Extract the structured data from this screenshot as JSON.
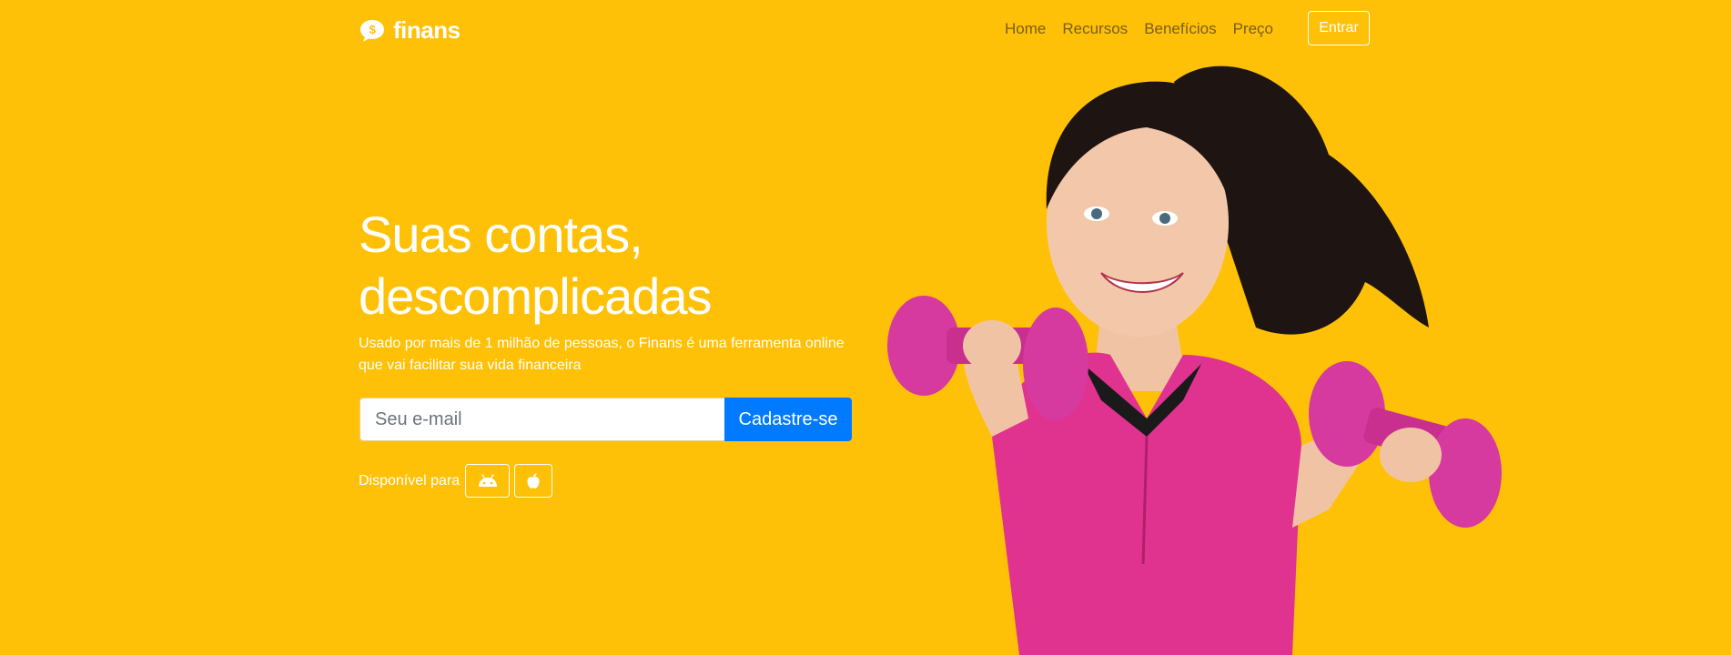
{
  "brand": {
    "name": "finans",
    "icon": "dollar-chat-bubble-icon"
  },
  "nav": {
    "items": [
      "Home",
      "Recursos",
      "Benefícios",
      "Preço"
    ],
    "login_label": "Entrar"
  },
  "hero": {
    "title_line1": "Suas contas,",
    "title_line2": "descomplicadas",
    "subtitle": "Usado por mais de 1 milhão de pessoas, o Finans é uma ferramenta online que vai facilitar sua vida financeira",
    "email_placeholder": "Seu e-mail",
    "signup_label": "Cadastre-se",
    "platforms_label": "Disponível para",
    "platform_icons": [
      "android-icon",
      "apple-icon"
    ],
    "image": "woman-with-pink-dumbbells-photo"
  },
  "colors": {
    "background": "#ffc107",
    "primary_button": "#007bff",
    "nav_text": "#6b5518",
    "accent_pink": "#e0338f"
  }
}
